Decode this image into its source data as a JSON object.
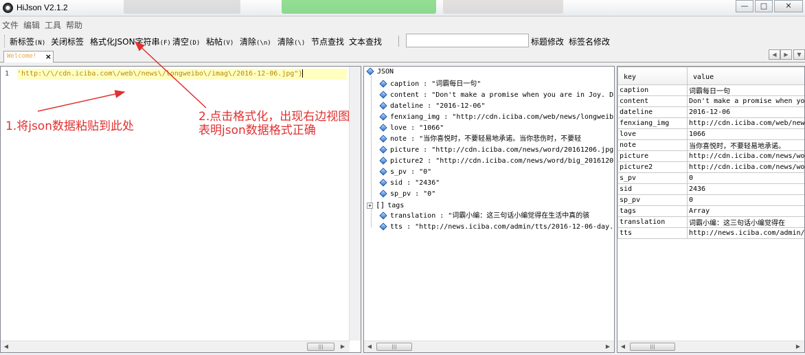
{
  "window": {
    "title": "HiJson V2.1.2",
    "controls": {
      "minimize": "—",
      "maximize": "□",
      "close": "✕"
    }
  },
  "menu": [
    "文件",
    "编辑",
    "工具",
    "帮助"
  ],
  "toolbar": {
    "buttons": [
      {
        "label": "新标签",
        "accel": "(N)"
      },
      {
        "label": "关闭标签",
        "accel": ""
      },
      {
        "label": "格式化JSON字符串",
        "accel": "(F)"
      },
      {
        "label": "清空",
        "accel": "(D)"
      },
      {
        "label": "粘帖",
        "accel": "(V)"
      },
      {
        "label": "清除",
        "accel": "(\\n)"
      },
      {
        "label": "清除",
        "accel": "(\\)"
      },
      {
        "label": "节点查找",
        "accel": ""
      },
      {
        "label": "文本查找",
        "accel": ""
      }
    ],
    "search_value": "",
    "title_edit": "标题修改",
    "tag_edit": "标签名修改"
  },
  "tab": {
    "label": "Welcome!",
    "close": "×"
  },
  "editor": {
    "line_number": "1",
    "line_text": "'http:\\/\\/cdn.iciba.com\\/web\\/news\\/longweibo\\/imag\\/2016-12-06.jpg\"}"
  },
  "tree": {
    "root": "JSON",
    "items": [
      {
        "text": "caption : \"词霸每日一句\""
      },
      {
        "text": "content : \"Don't make a promise when you are in Joy. D"
      },
      {
        "text": "dateline : \"2016-12-06\""
      },
      {
        "text": "fenxiang_img : \"http://cdn.iciba.com/web/news/longweib"
      },
      {
        "text": "love : \"1066\""
      },
      {
        "text": "note : \"当你喜悦时，不要轻易地承诺。当你悲伤时，不要轻"
      },
      {
        "text": "picture : \"http://cdn.iciba.com/news/word/20161206.jpg"
      },
      {
        "text": "picture2 : \"http://cdn.iciba.com/news/word/big_2016120"
      },
      {
        "text": "s_pv : \"0\""
      },
      {
        "text": "sid : \"2436\""
      },
      {
        "text": "sp_pv : \"0\""
      },
      {
        "text": "tags",
        "array": true,
        "icon": "[]",
        "expander": "+"
      },
      {
        "text": "translation : \"词霸小编：这三句话小编觉得在生活中真的骇"
      },
      {
        "text": "tts : \"http://news.iciba.com/admin/tts/2016-12-06-day."
      }
    ]
  },
  "table": {
    "headers": [
      "key",
      "value"
    ],
    "rows": [
      [
        "caption",
        "词霸每日一句"
      ],
      [
        "content",
        "Don't make a promise when you"
      ],
      [
        "dateline",
        "2016-12-06"
      ],
      [
        "fenxiang_img",
        "http://cdn.iciba.com/web/news"
      ],
      [
        "love",
        "1066"
      ],
      [
        "note",
        "当你喜悦时，不要轻易地承诺。"
      ],
      [
        "picture",
        "http://cdn.iciba.com/news/wor"
      ],
      [
        "picture2",
        "http://cdn.iciba.com/news/wor"
      ],
      [
        "s_pv",
        "0"
      ],
      [
        "sid",
        "2436"
      ],
      [
        "sp_pv",
        "0"
      ],
      [
        "tags",
        "Array"
      ],
      [
        "translation",
        "词霸小编：这三句话小编觉得在"
      ],
      [
        "tts",
        "http://news.iciba.com/admin/"
      ]
    ]
  },
  "annotations": {
    "step1": "1.将json数据粘贴到此处",
    "step2_line1": "2.点击格式化，出现右边视图",
    "step2_line2": "表明json数据格式正确",
    "color": "#e03030"
  },
  "scrollbar": {
    "grip": "|||",
    "left": "◀",
    "right": "▶",
    "up": "▲",
    "down": "▼"
  }
}
